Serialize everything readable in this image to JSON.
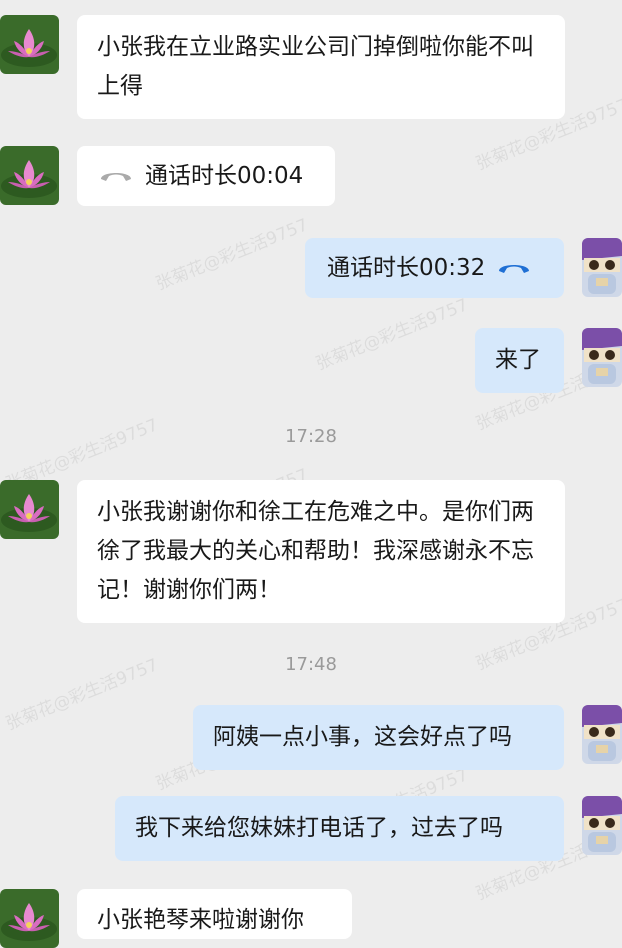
{
  "watermark": "张菊花@彩生活9757",
  "contacts": {
    "other": {
      "avatar_icon": "lotus-flower-avatar-icon"
    },
    "self": {
      "avatar_icon": "cartoon-robot-avatar-icon"
    }
  },
  "messages": [
    {
      "side": "in",
      "text": "小张我在立业路实业公司门掉倒啦你能不叫上得"
    },
    {
      "side": "in",
      "type": "call",
      "text": "通话时长00:04",
      "icon": "phone-hangup-icon",
      "icon_color": "#aaaaaa"
    },
    {
      "side": "out",
      "type": "call",
      "text": "通话时长00:32",
      "icon": "phone-hangup-icon",
      "icon_color": "#1f6fd4"
    },
    {
      "side": "out",
      "text": "来了"
    },
    {
      "type": "time",
      "text": "17:28"
    },
    {
      "side": "in",
      "text": "小张我谢谢你和徐工在危难之中。是你们两徐了我最大的关心和帮助！我深感谢永不忘记！谢谢你们两！"
    },
    {
      "type": "time",
      "text": "17:48"
    },
    {
      "side": "out",
      "text": "阿姨一点小事，这会好点了吗"
    },
    {
      "side": "out",
      "text": "我下来给您妹妹打电话了，过去了吗"
    },
    {
      "side": "in",
      "text": "小张艳琴来啦谢谢你"
    }
  ],
  "colors": {
    "background": "#ededed",
    "incoming_bubble": "#ffffff",
    "outgoing_bubble": "#d6e8fb",
    "timestamp": "#9a9a9a"
  }
}
